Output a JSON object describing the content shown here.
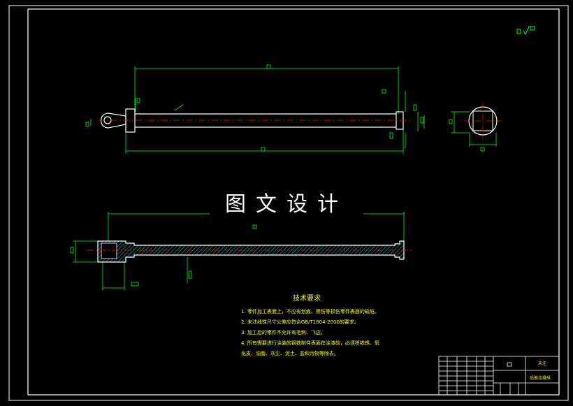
{
  "watermark": "图文设计",
  "tech_requirements": {
    "title": "技术要求",
    "items": [
      "1. 零件加工表面上，不应有划痕、擦伤等损伤零件表面的缺陷。",
      "2. 未注线性尺寸公差应符合GB/T1804-2000的要求。",
      "3. 加工后的零件不允许有毛刺、飞边。",
      "4. 所有需要进行涂装的钢铁制件表面在涂漆前，必须将铁锈、氧",
      "化皮、油脂、灰尘、泥土、盐和污物等除去。"
    ]
  },
  "title_block": {
    "material": "未注",
    "part_name": "后推拉操纵"
  },
  "colors": {
    "border": "#ffffff",
    "dimension": "#00ff00",
    "center_line": "#ff0000",
    "hatch": "#00ffff",
    "text": "#ffff00"
  }
}
